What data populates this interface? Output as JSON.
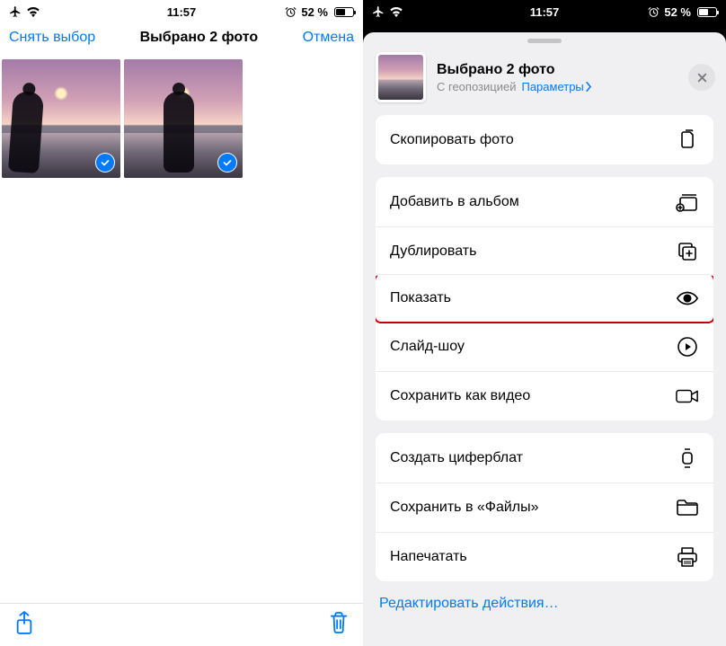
{
  "status": {
    "time": "11:57",
    "battery_text": "52 %"
  },
  "left": {
    "deselect": "Снять выбор",
    "title": "Выбрано 2 фото",
    "cancel": "Отмена"
  },
  "sheet": {
    "title": "Выбрано 2 фото",
    "subtitle": "С геопозицией",
    "options": "Параметры",
    "edit_actions": "Редактировать действия…",
    "actions": {
      "copy": "Скопировать фото",
      "add_album": "Добавить в альбом",
      "duplicate": "Дублировать",
      "show": "Показать",
      "slideshow": "Слайд-шоу",
      "save_video": "Сохранить как видео",
      "watchface": "Создать циферблат",
      "save_files": "Сохранить в «Файлы»",
      "print": "Напечатать"
    }
  }
}
